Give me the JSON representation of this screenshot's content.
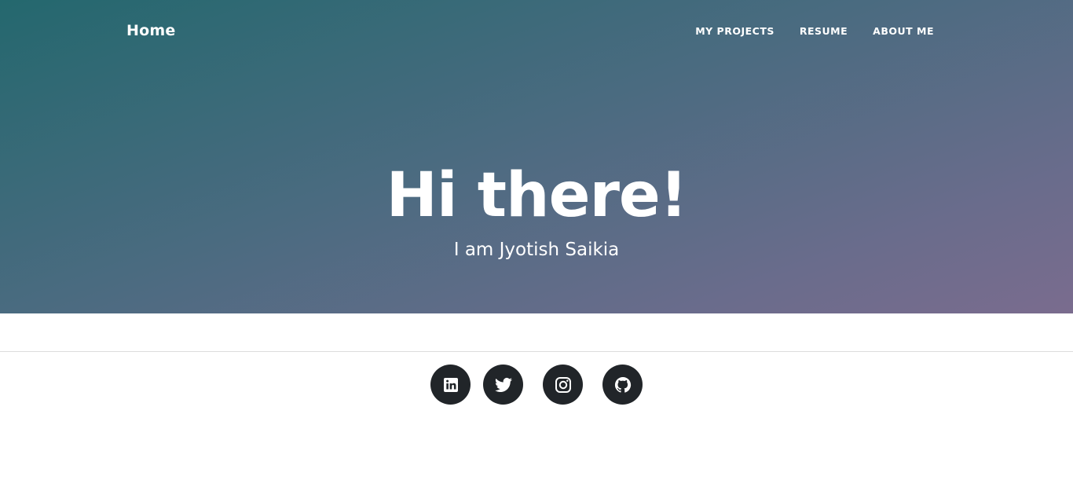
{
  "navbar": {
    "brand": "Home",
    "links": [
      "MY PROJECTS",
      "RESUME",
      "ABOUT ME"
    ]
  },
  "hero": {
    "heading": "Hi there!",
    "subheading": "I am Jyotish Saikia",
    "gradient_colors": [
      "#24686e",
      "#7a6c8e"
    ]
  },
  "social": {
    "icons": [
      "linkedin-icon",
      "twitter-icon",
      "instagram-icon",
      "github-icon"
    ],
    "button_color": "#212529"
  }
}
